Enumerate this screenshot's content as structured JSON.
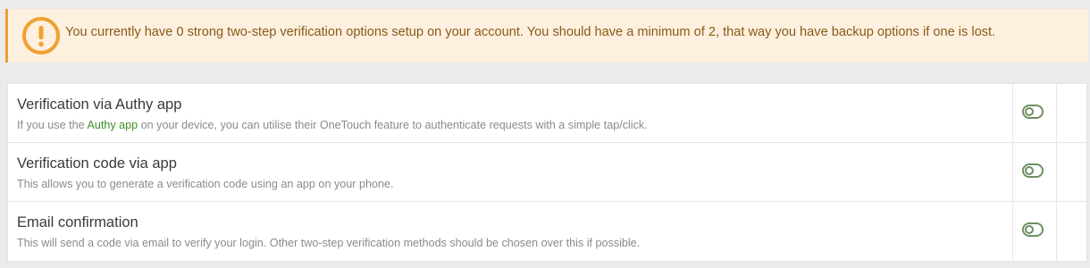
{
  "notice": {
    "icon": "warning-icon",
    "color": "#f0a030",
    "text": "You currently have 0 strong two-step verification options setup on your account. You should have a minimum of 2, that way you have backup options if one is lost."
  },
  "options": [
    {
      "title": "Verification via Authy app",
      "desc_before": "If you use the",
      "desc_link": "Authy app",
      "desc_after": "on your device, you can utilise their OneTouch feature to authenticate requests with a simple tap/click.",
      "enabled": false
    },
    {
      "title": "Verification code via app",
      "desc": "This allows you to generate a verification code using an app on your phone.",
      "enabled": false
    },
    {
      "title": "Email confirmation",
      "desc": "This will send a code via email to verify your login. Other two-step verification methods should be chosen over this if possible.",
      "enabled": false
    }
  ],
  "colors": {
    "toggle": "#6f8f5f",
    "link": "#3e8e2a",
    "notice_bg": "#fdf0df",
    "notice_text": "#8a5a17"
  }
}
